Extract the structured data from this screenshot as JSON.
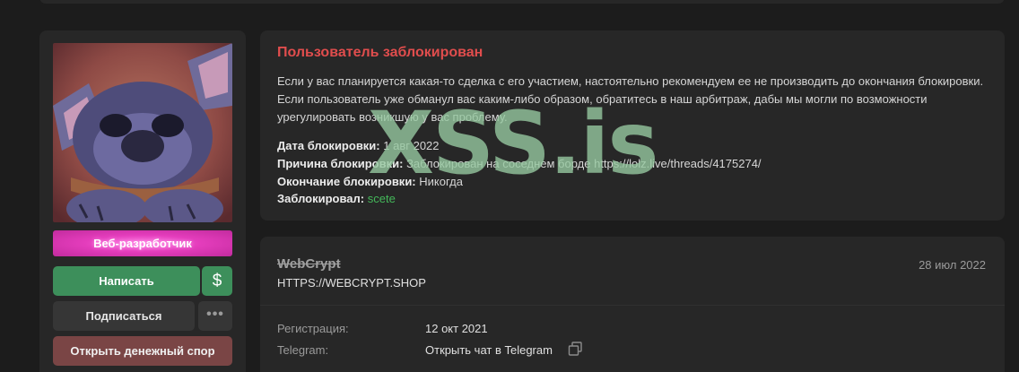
{
  "sidebar": {
    "role": "Веб-разработчик",
    "write_label": "Написать",
    "dollar_label": "$",
    "subscribe_label": "Подписаться",
    "more_label": "•••",
    "dispute_label": "Открыть денежный спор"
  },
  "ban": {
    "title": "Пользователь заблокирован",
    "text": "Если у вас планируется какая-то сделка с его участием, настоятельно рекомендуем ее не производить до окончания блокировки. Если пользователь уже обманул вас каким-либо образом, обратитесь в наш арбитраж, дабы мы могли по возможности урегулировать возникшую у вас проблему.",
    "date_label": "Дата блокировки:",
    "date_value": "1 авг 2022",
    "reason_label": "Причина блокировки:",
    "reason_value": "Заблокирован на соседнем борде https://lolz.live/threads/4175274/",
    "end_label": "Окончание блокировки:",
    "end_value": "Никогда",
    "by_label": "Заблокировал:",
    "by_value": "scete"
  },
  "profile": {
    "username": "WebCrypt",
    "date": "28 июл 2022",
    "status": "HTTPS://WEBCRYPT.SHOP",
    "reg_label": "Регистрация:",
    "reg_value": "12 окт 2021",
    "tg_label": "Telegram:",
    "tg_value": "Открыть чат в Telegram"
  },
  "watermark": "XSS.is",
  "colors": {
    "accent_green": "#3d8f5b",
    "ban_title": "#e04d4d",
    "link_green": "#44b85a",
    "dispute": "#7a4545"
  },
  "icons": [
    "copy-icon"
  ]
}
